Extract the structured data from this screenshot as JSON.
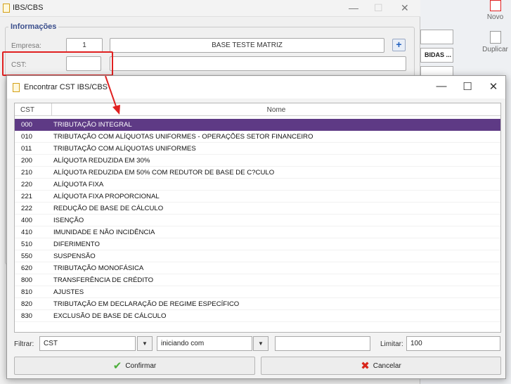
{
  "back_window": {
    "title": "IBS/CBS",
    "group_title": "Informações",
    "empresa_label": "Empresa:",
    "empresa_value": "1",
    "empresa_name": "BASE TESTE MATRIZ",
    "cst_label": "CST:",
    "cst_value": ""
  },
  "right_panel": {
    "field_text": "BIDAS ...",
    "novo_label": "Novo",
    "duplicar_label": "Duplicar"
  },
  "dialog": {
    "title": "Encontrar CST IBS/CBS",
    "columns": {
      "cst": "CST",
      "nome": "Nome"
    },
    "rows": [
      {
        "cst": "000",
        "nome": "TRIBUTAÇÃO INTEGRAL"
      },
      {
        "cst": "010",
        "nome": "TRIBUTAÇÃO COM ALÍQUOTAS UNIFORMES - OPERAÇÕES SETOR FINANCEIRO"
      },
      {
        "cst": "011",
        "nome": "TRIBUTAÇÃO COM ALÍQUOTAS UNIFORMES"
      },
      {
        "cst": "200",
        "nome": "ALÍQUOTA REDUZIDA EM 30%"
      },
      {
        "cst": "210",
        "nome": "ALÍQUOTA REDUZIDA EM 50% COM REDUTOR DE BASE DE C?CULO"
      },
      {
        "cst": "220",
        "nome": "ALÍQUOTA FIXA"
      },
      {
        "cst": "221",
        "nome": "ALÍQUOTA FIXA PROPORCIONAL"
      },
      {
        "cst": "222",
        "nome": "REDUÇÃO DE BASE DE CÁLCULO"
      },
      {
        "cst": "400",
        "nome": "ISENÇÃO"
      },
      {
        "cst": "410",
        "nome": "IMUNIDADE E NÃO INCIDÊNCIA"
      },
      {
        "cst": "510",
        "nome": "DIFERIMENTO"
      },
      {
        "cst": "550",
        "nome": "SUSPENSÃO"
      },
      {
        "cst": "620",
        "nome": "TRIBUTAÇÃO MONOFÁSICA"
      },
      {
        "cst": "800",
        "nome": "TRANSFERÊNCIA DE CRÉDITO"
      },
      {
        "cst": "810",
        "nome": "AJUSTES"
      },
      {
        "cst": "820",
        "nome": "TRIBUTAÇÃO EM DECLARAÇÃO DE REGIME ESPECÍFICO"
      },
      {
        "cst": "830",
        "nome": "EXCLUSÃO DE BASE DE CÁLCULO"
      }
    ],
    "selected_row_index": 0,
    "filter": {
      "label": "Filtrar:",
      "field_value": "CST",
      "mode_value": "iniciando com",
      "search_value": "",
      "limit_label": "Limitar:",
      "limit_value": "100"
    },
    "buttons": {
      "confirm": "Confirmar",
      "cancel": "Cancelar"
    }
  },
  "colors": {
    "selection": "#5e3a85",
    "annotation_red": "#e02020",
    "group_title": "#3a4e8c"
  }
}
